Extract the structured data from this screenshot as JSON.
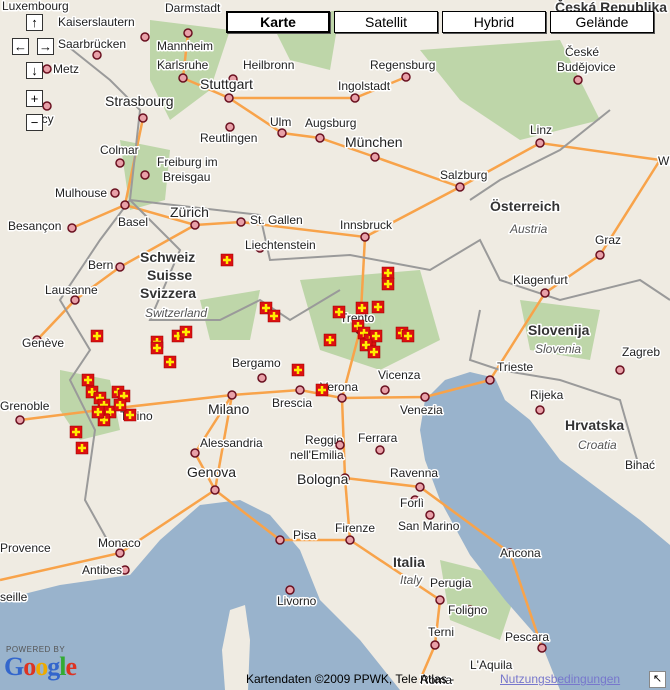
{
  "map_types": [
    {
      "label": "Karte",
      "selected": true
    },
    {
      "label": "Satellit",
      "selected": false
    },
    {
      "label": "Hybrid",
      "selected": false
    },
    {
      "label": "Gelände",
      "selected": false
    }
  ],
  "controls": {
    "pan_up": "↑",
    "pan_left": "←",
    "pan_right": "→",
    "pan_down": "↓",
    "zoom_in": "+",
    "zoom_out": "−"
  },
  "labels": {
    "cities": [
      "Luxembourg",
      "Kaiserslautern",
      "Darmstadt",
      "Saarbrücken",
      "Mannheim",
      "Metz",
      "Karlsruhe",
      "Heilbronn",
      "Stuttgart",
      "Regensburg",
      "Ingolstadt",
      "České",
      "Budějovice",
      "Strasbourg",
      "ncy",
      "Reutlingen",
      "Ulm",
      "Augsburg",
      "München",
      "Linz",
      "Wi",
      "Colmar",
      "Freiburg im",
      "Breisgau",
      "Mulhouse",
      "Salzburg",
      "Basel",
      "Zürich",
      "St. Gallen",
      "Besançon",
      "Innsbruck",
      "Graz",
      "Liechtenstein",
      "Bern",
      "Klagenfurt",
      "Lausanne",
      "Genève",
      "Trento",
      "Zagreb",
      "Bergamo",
      "Vicenza",
      "Trieste",
      "Verona",
      "Milano",
      "Brescia",
      "Venezia",
      "Rijeka",
      "Grenoble",
      "Torino",
      "Alessandria",
      "Reggio",
      "nell'Emilia",
      "Ferrara",
      "Bihać",
      "Genova",
      "Bologna",
      "Ravenna",
      "Forlì",
      "San Marino",
      "Pisa",
      "Firenze",
      "Monaco",
      "Provence",
      "Ancona",
      "Antibes",
      "Livorno",
      "Perugia",
      "Foligno",
      "seille",
      "Terni",
      "Pescara",
      "L'Aquila",
      "Roma"
    ],
    "countries": [
      "Česká Republika",
      "Österreich",
      "Schweiz",
      "Suisse",
      "Svizzera",
      "Slovenija",
      "Hrvatska",
      "Italia"
    ],
    "countries_en": [
      "Austria",
      "Switzerland",
      "Slovenia",
      "Croatia",
      "Italy"
    ]
  },
  "markers": {
    "color": "#dd1111",
    "cross_color": "#ffee00"
  },
  "colors": {
    "land": "#efebe2",
    "sea": "#99b3cc",
    "forest": "#b5d29f",
    "highway": "#f8a34a",
    "border": "#9a9a9a"
  },
  "footer": {
    "powered_by": "POWERED BY",
    "logo": "Google",
    "attribution": "Kartendaten ©2009 PPWK, Tele Atlas -",
    "terms": "Nutzungsbedingungen",
    "corner_icon": "↖"
  }
}
